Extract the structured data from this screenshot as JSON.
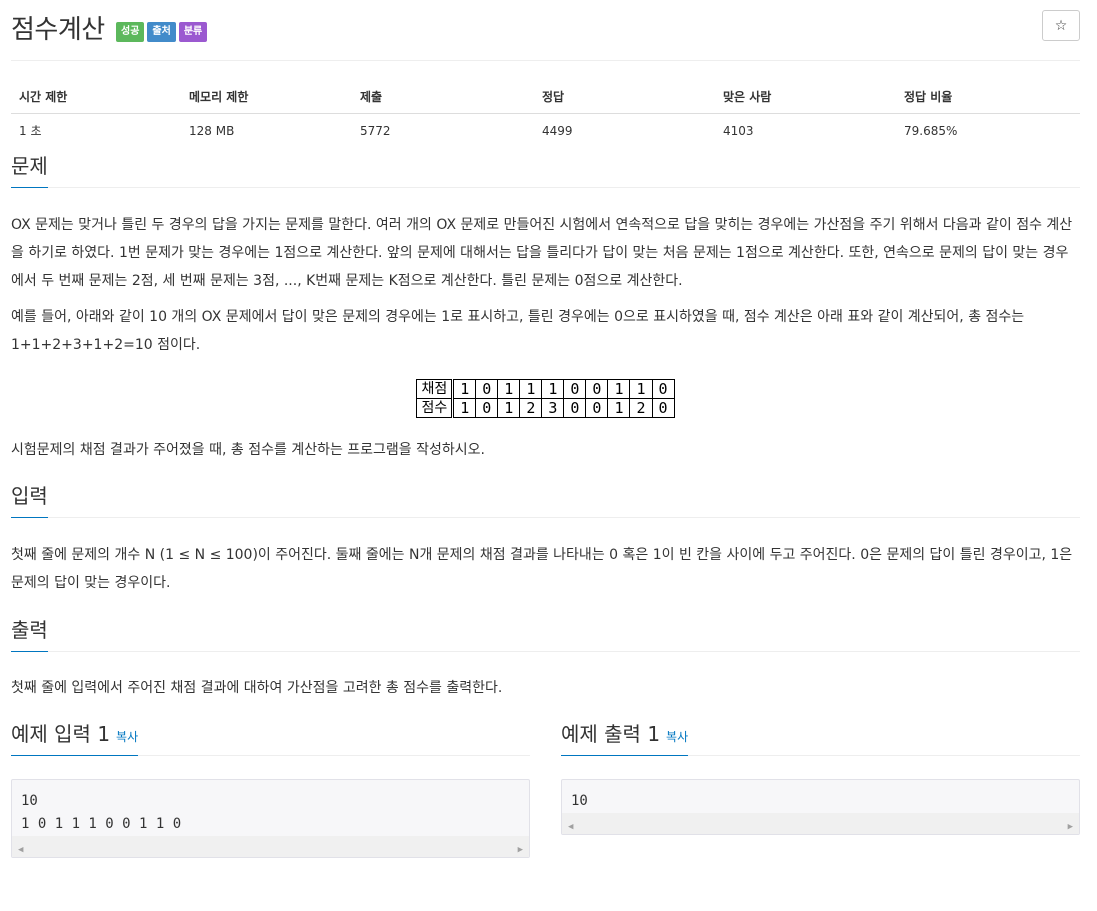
{
  "problem": {
    "title": "점수계산",
    "badges": [
      {
        "label": "성공",
        "color": "#5cb85c"
      },
      {
        "label": "출처",
        "color": "#428bca"
      },
      {
        "label": "분류",
        "color": "#9b59d0"
      }
    ],
    "star_icon": "☆"
  },
  "stats": {
    "headers": [
      "시간 제한",
      "메모리 제한",
      "제출",
      "정답",
      "맞은 사람",
      "정답 비율"
    ],
    "values": [
      "1 초",
      "128 MB",
      "5772",
      "4499",
      "4103",
      "79.685%"
    ]
  },
  "sections": {
    "description": {
      "title": "문제",
      "p1": "OX 문제는 맞거나 틀린 두 경우의 답을 가지는 문제를 말한다. 여러 개의 OX 문제로 만들어진 시험에서 연속적으로 답을 맞히는 경우에는 가산점을 주기 위해서 다음과 같이 점수 계산을 하기로 하였다. 1번 문제가 맞는 경우에는 1점으로 계산한다. 앞의 문제에 대해서는 답을 틀리다가 답이 맞는 처음 문제는 1점으로 계산한다. 또한, 연속으로 문제의 답이 맞는 경우에서 두 번째 문제는 2점, 세 번째 문제는 3점, ..., K번째 문제는 K점으로 계산한다. 틀린 문제는 0점으로 계산한다.",
      "p2": "예를 들어, 아래와 같이 10 개의 OX 문제에서 답이 맞은 문제의 경우에는 1로 표시하고, 틀린 경우에는 0으로 표시하였을 때, 점수 계산은 아래 표와 같이 계산되어, 총 점수는 1+1+2+3+1+2=10 점이다.",
      "table": {
        "row1_label": "채점",
        "row1": [
          "1",
          "0",
          "1",
          "1",
          "1",
          "0",
          "0",
          "1",
          "1",
          "0"
        ],
        "row2_label": "점수",
        "row2": [
          "1",
          "0",
          "1",
          "2",
          "3",
          "0",
          "0",
          "1",
          "2",
          "0"
        ]
      },
      "p3": "시험문제의 채점 결과가 주어졌을 때, 총 점수를 계산하는 프로그램을 작성하시오."
    },
    "input": {
      "title": "입력",
      "text": "첫째 줄에 문제의 개수 N (1 ≤ N ≤ 100)이 주어진다. 둘째 줄에는 N개 문제의 채점 결과를 나타내는 0 혹은 1이 빈 칸을 사이에 두고 주어진다. 0은 문제의 답이 틀린 경우이고, 1은 문제의 답이 맞는 경우이다."
    },
    "output": {
      "title": "출력",
      "text": "첫째 줄에 입력에서 주어진 채점 결과에 대하여 가산점을 고려한 총 점수를 출력한다."
    }
  },
  "samples": {
    "input_title": "예제 입력 1",
    "output_title": "예제 출력 1",
    "copy_label": "복사",
    "input_text": "10\n1 0 1 1 1 0 0 1 1 0",
    "output_text": "10",
    "scroll_left": "◀",
    "scroll_right": "▶"
  }
}
